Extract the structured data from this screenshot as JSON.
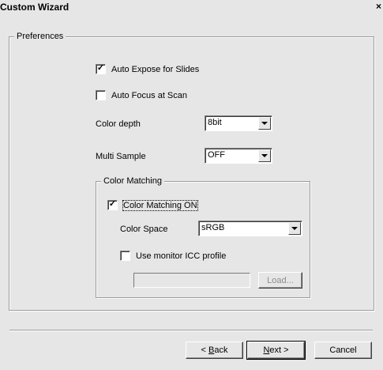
{
  "window": {
    "title": "Custom Wizard",
    "close_glyph": "×"
  },
  "preferences": {
    "legend": "Preferences",
    "auto_expose": {
      "label": "Auto Expose for Slides",
      "checked": true
    },
    "auto_focus": {
      "label": "Auto Focus at Scan",
      "checked": false
    },
    "color_depth": {
      "label": "Color depth",
      "value": "8bit"
    },
    "multi_sample": {
      "label": "Multi Sample",
      "value": "OFF"
    }
  },
  "color_matching": {
    "legend": "Color Matching",
    "enable": {
      "label": "Color Matching ON",
      "checked": true
    },
    "color_space": {
      "label": "Color Space",
      "value": "sRGB"
    },
    "monitor_icc": {
      "label": "Use monitor ICC profile",
      "checked": false
    },
    "profile_path": "",
    "load_label": "Load..."
  },
  "footer": {
    "back_mnemonic": "B",
    "back_rest": "ack",
    "next_mnemonic": "N",
    "next_rest": "ext >",
    "cancel_label": "Cancel"
  },
  "icons": {
    "checkmark": "✓",
    "dropdown": "chevron-down-icon"
  }
}
